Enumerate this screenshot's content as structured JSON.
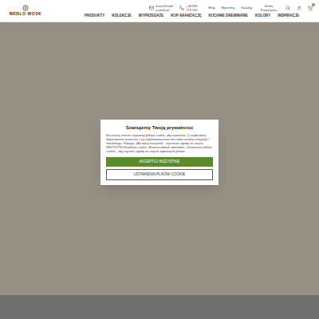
{
  "header": {
    "logo": "MEBLO·WOSK",
    "email": "biuro@meblo-wosk.pl",
    "phone": "+48 881 779 205",
    "links": [
      "Blog",
      "Wyszukaj",
      "Katalog",
      "Strefa Projektanta"
    ],
    "cart_count": "0"
  },
  "nav": [
    {
      "label": "PRODUKTY"
    },
    {
      "label": "KOLEKCJE"
    },
    {
      "label": "WYPRZEDAŻE"
    },
    {
      "label": "KUP ARANŻACJĘ"
    },
    {
      "label": "KUCHNIE DREWNIANE"
    },
    {
      "label": "KOLORY"
    },
    {
      "label": "INSPIRACJE"
    }
  ],
  "cookie_dialog": {
    "title": "Szanujemy Twoją prywatność",
    "text": "Na naszej stronie używamy plików cookie, aby zapewnić Ci najbardziej dopasowane wrażenia z jej użytkowania oraz do celów analizy statystyk i marketingu. Klikając „Akceptuj wszystkie”, wyrażasz zgodę na użycie WSZYSTKICH plików cookie. Możesz jednak odwiedzić „Ustawienia plików cookie”, aby wyrazić zgodę na użycie wybranych plików.",
    "buttons": [
      {
        "label": "AKCEPTUJ WSZYSTKIE",
        "kind": "primary"
      },
      {
        "label": "USTAWIENIA PLIKÓW COOKIE",
        "kind": "secondary"
      }
    ]
  }
}
